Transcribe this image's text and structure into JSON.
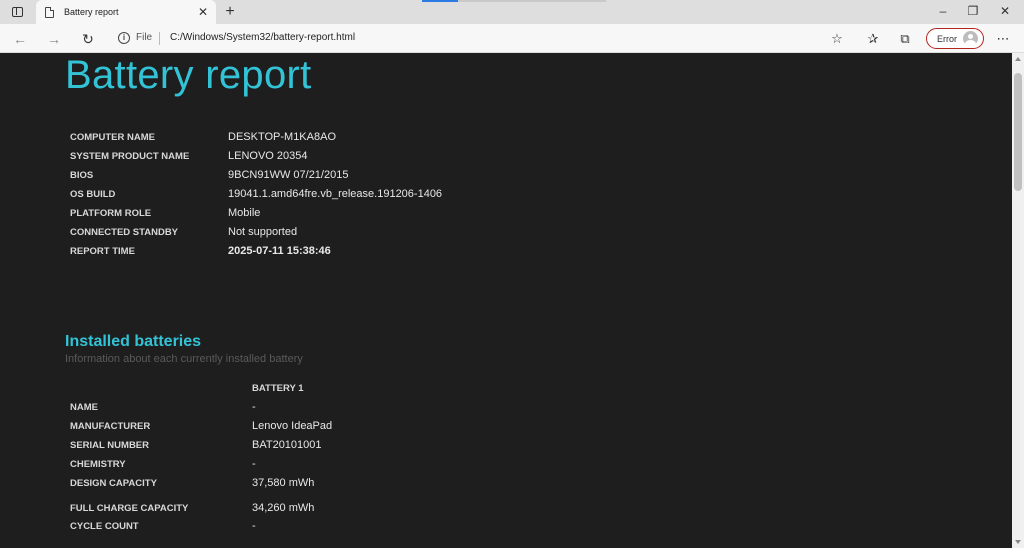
{
  "browser": {
    "tab_title": "Battery report",
    "new_tab": "+",
    "file_label": "File",
    "url": "C:/Windows/System32/battery-report.html",
    "error_label": "Error",
    "window_minimize": "–",
    "window_restore": "❐",
    "window_close": "✕"
  },
  "report": {
    "title": "Battery report",
    "system_info": [
      {
        "label": "COMPUTER NAME",
        "value": "DESKTOP-M1KA8AO"
      },
      {
        "label": "SYSTEM PRODUCT NAME",
        "value": "LENOVO 20354"
      },
      {
        "label": "BIOS",
        "value": "9BCN91WW 07/21/2015"
      },
      {
        "label": "OS BUILD",
        "value": "19041.1.amd64fre.vb_release.191206-1406"
      },
      {
        "label": "PLATFORM ROLE",
        "value": "Mobile"
      },
      {
        "label": "CONNECTED STANDBY",
        "value": "Not supported"
      },
      {
        "label": "REPORT TIME",
        "value": "2025-07-11  15:38:46"
      }
    ],
    "installed_batteries": {
      "title": "Installed batteries",
      "subtitle": "Information about each currently installed battery",
      "column_header": "BATTERY 1",
      "rows": [
        {
          "label": "NAME",
          "value": "-"
        },
        {
          "label": "MANUFACTURER",
          "value": "Lenovo IdeaPad"
        },
        {
          "label": "SERIAL NUMBER",
          "value": "BAT20101001"
        },
        {
          "label": "CHEMISTRY",
          "value": "-"
        },
        {
          "label": "DESIGN CAPACITY",
          "value": "37,580 mWh"
        },
        {
          "label": "FULL CHARGE CAPACITY",
          "value": "34,260 mWh"
        },
        {
          "label": "CYCLE COUNT",
          "value": "-"
        }
      ]
    }
  },
  "colors": {
    "accent": "#33c3d6",
    "background": "#1e1e1e",
    "error_border": "#b3261e"
  }
}
